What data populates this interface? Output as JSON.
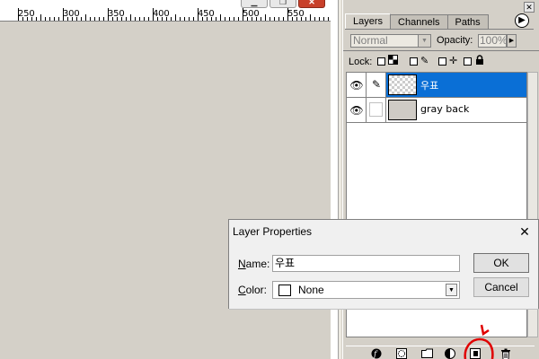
{
  "window": {
    "minimize_glyph": "▁",
    "restore_glyph": "❐",
    "close_glyph": "✕",
    "close_color": "#c8402a"
  },
  "ruler": {
    "labels": [
      "250",
      "300",
      "350",
      "400",
      "450",
      "500",
      "550"
    ]
  },
  "palette": {
    "tabs": [
      "Layers",
      "Channels",
      "Paths"
    ],
    "active_tab": "Layers",
    "flyout_glyph": "▶",
    "blend_mode": "Normal",
    "opacity_label": "Opacity:",
    "opacity_value": "100%",
    "lock_label": "Lock:",
    "layers": [
      {
        "name": "우표",
        "visible": true,
        "selected": true,
        "linked_icon": "brush-icon",
        "thumbnail": "transparent"
      },
      {
        "name": "gray back",
        "visible": true,
        "selected": false,
        "linked_icon": "",
        "thumbnail": "gray"
      }
    ],
    "selection_color": "#0a6fd6",
    "bottom_icons": [
      "layer-style-icon",
      "mask-icon",
      "new-set-icon",
      "adjustment-layer-icon",
      "new-layer-icon",
      "trash-icon"
    ],
    "highlight_color": "#e00000"
  },
  "dialog": {
    "title": "Layer Properties",
    "close_glyph": "✕",
    "name_label_underlined": "N",
    "name_label_rest": "ame:",
    "name_value": "우표",
    "color_label_underlined": "C",
    "color_label_rest": "olor:",
    "color_value": "None",
    "ok_label": "OK",
    "cancel_label": "Cancel"
  }
}
